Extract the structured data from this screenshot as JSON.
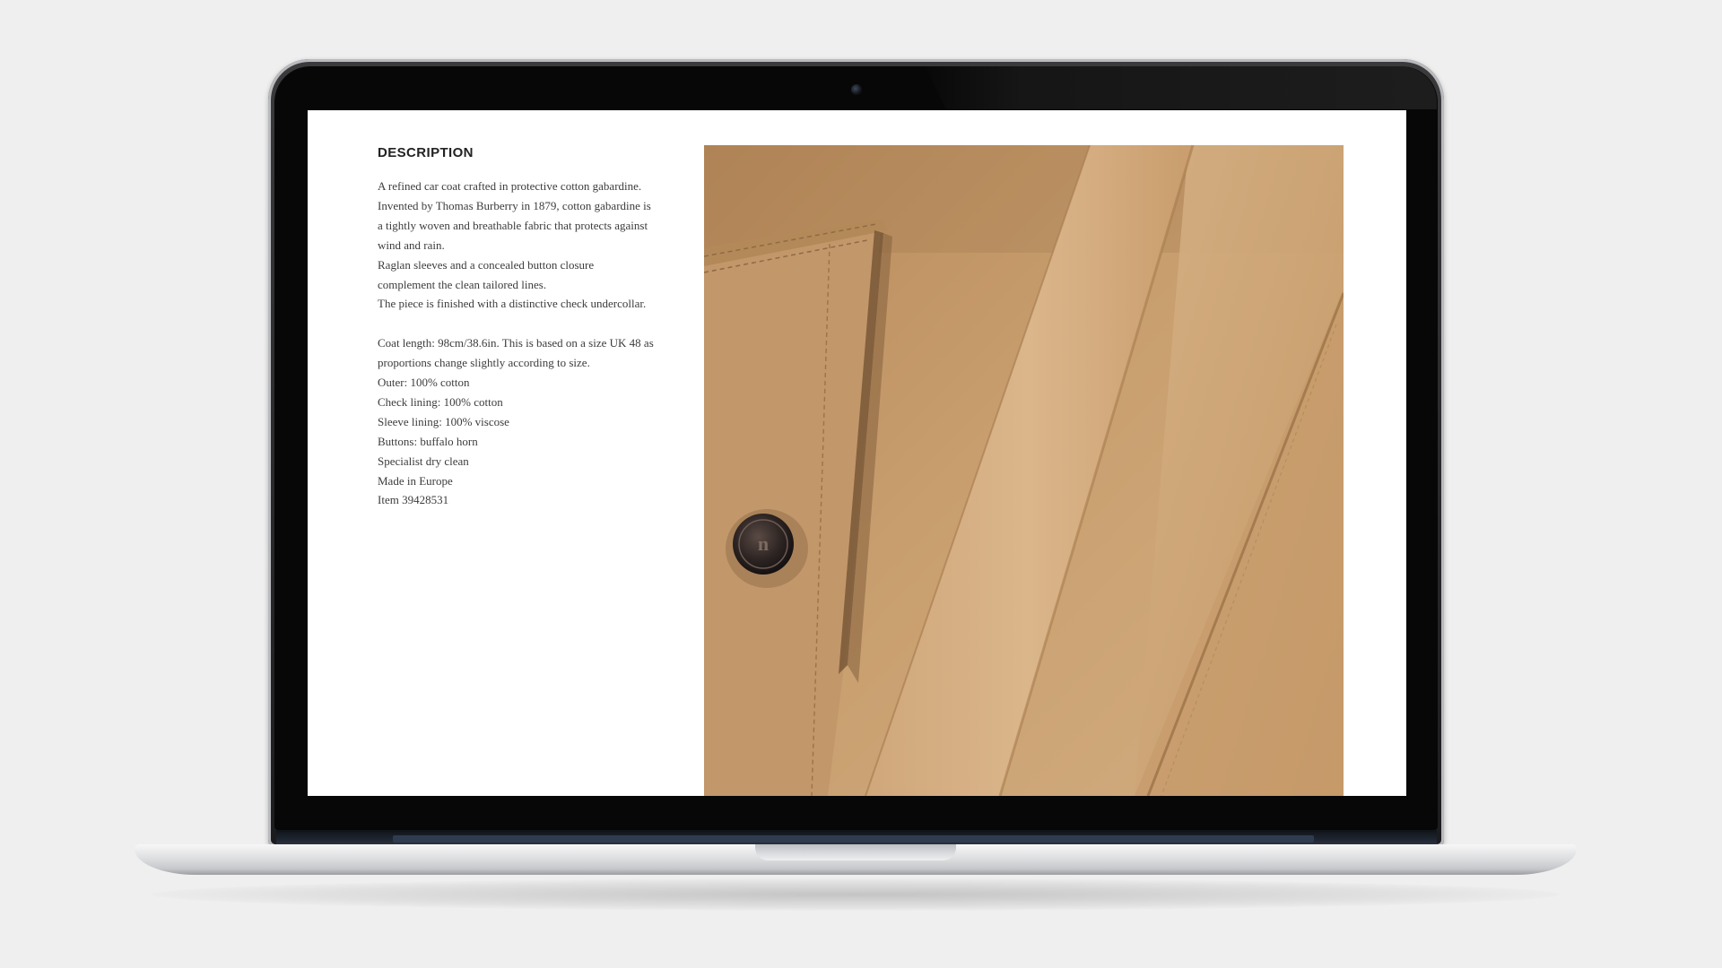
{
  "product_page": {
    "description_heading": "DESCRIPTION",
    "description_lines": [
      "A refined car coat crafted in protective cotton gabardine.",
      "Invented by Thomas Burberry in 1879, cotton gabardine is",
      "a tightly woven and breathable fabric that protects against",
      "wind and rain.",
      "Raglan sleeves and a concealed button closure",
      "complement the clean tailored lines.",
      "The piece is finished with a distinctive check undercollar."
    ],
    "detail_lines": [
      "Coat length: 98cm/38.6in. This is based on a size UK 48 as",
      "proportions change slightly according to size.",
      "Outer: 100% cotton",
      "Check lining: 100% cotton",
      "Sleeve lining: 100% viscose",
      "Buttons: buffalo horn",
      "Specialist dry clean",
      "Made in Europe",
      "Item 39428531"
    ],
    "image": {
      "subject": "close-up of honey-beige cotton gabardine car coat with pocket and horn button",
      "fabric_color": "#c79c6c",
      "shadow_color": "#8d6a45",
      "highlight_color": "#dcbb93",
      "button_color": "#2a2422"
    }
  },
  "device": {
    "frame": "laptop",
    "bezel_color": "#070707",
    "body_color": "#d9dadc"
  }
}
